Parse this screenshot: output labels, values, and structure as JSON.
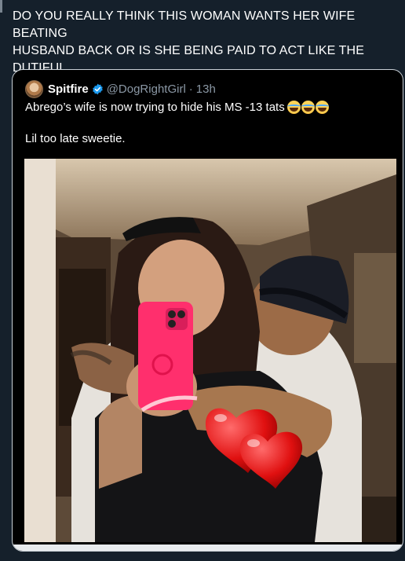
{
  "post": {
    "text": "DO YOU REALLY THINK THIS WOMAN WANTS HER WIFE BEATING\nHUSBAND BACK OR IS SHE BEING PAID TO ACT LIKE THE DUTIFUL\nWIFE..."
  },
  "quote": {
    "name": "Spitfire",
    "handle": "@DogRightGirl",
    "separator": "·",
    "time": "13h",
    "line1": "Abrego’s wife is now trying to hide his MS -13 tats",
    "line2": "Lil too late sweetie.",
    "emojis": [
      "face-with-tears-of-joy",
      "face-with-tears-of-joy",
      "face-with-tears-of-joy"
    ]
  },
  "colors": {
    "background": "#15202b",
    "card": "#000000",
    "verified": "#1d9bf0",
    "muted": "#8b98a5"
  }
}
